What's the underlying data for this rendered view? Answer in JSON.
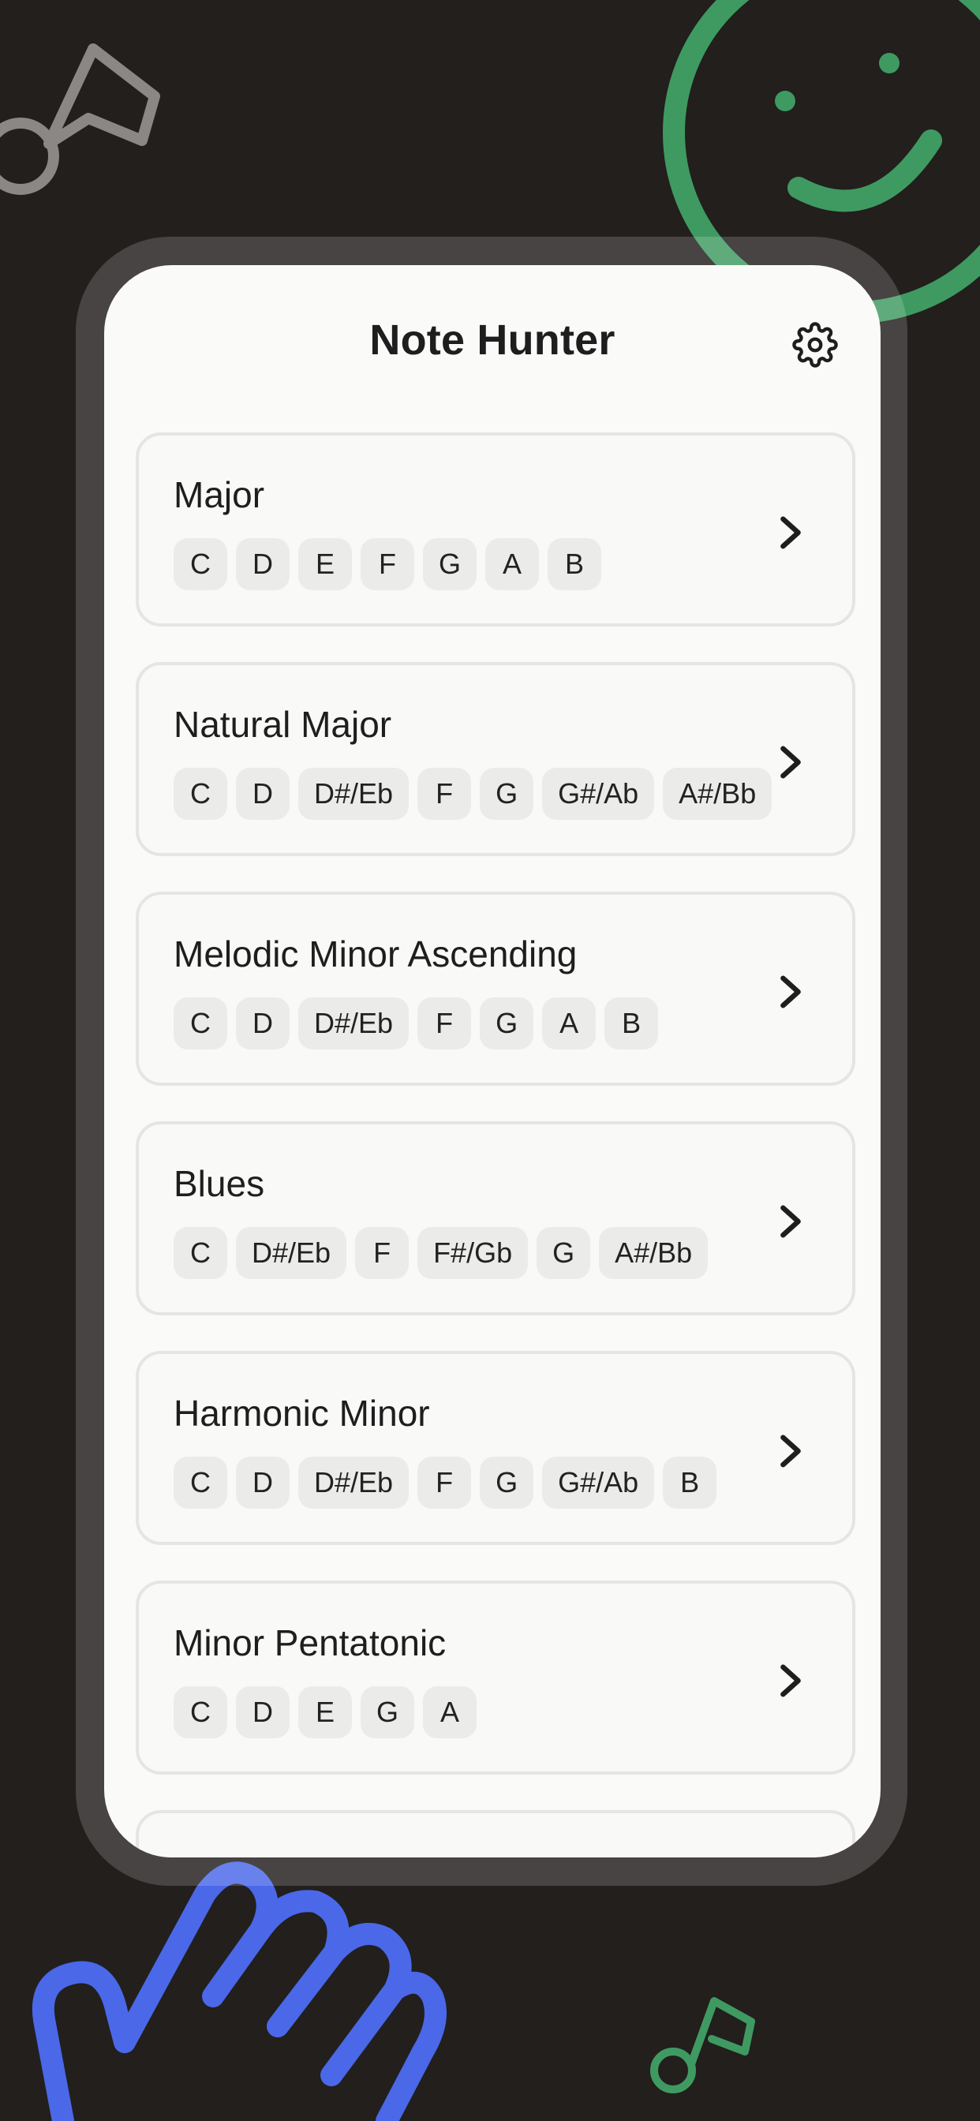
{
  "app": {
    "title": "Note Hunter",
    "settings_icon": "gear-icon"
  },
  "scales": [
    {
      "name": "Major",
      "notes": [
        "C",
        "D",
        "E",
        "F",
        "G",
        "A",
        "B"
      ]
    },
    {
      "name": "Natural Major",
      "notes": [
        "C",
        "D",
        "D#/Eb",
        "F",
        "G",
        "G#/Ab",
        "A#/Bb"
      ]
    },
    {
      "name": "Melodic Minor Ascending",
      "notes": [
        "C",
        "D",
        "D#/Eb",
        "F",
        "G",
        "A",
        "B"
      ]
    },
    {
      "name": "Blues",
      "notes": [
        "C",
        "D#/Eb",
        "F",
        "F#/Gb",
        "G",
        "A#/Bb"
      ]
    },
    {
      "name": "Harmonic Minor",
      "notes": [
        "C",
        "D",
        "D#/Eb",
        "F",
        "G",
        "G#/Ab",
        "B"
      ]
    },
    {
      "name": "Minor Pentatonic",
      "notes": [
        "C",
        "D",
        "E",
        "G",
        "A"
      ]
    }
  ],
  "colors": {
    "background": "#221f1d",
    "screen": "#fafaf8",
    "accent_green": "#3f9a61",
    "accent_blue": "#4a68e8",
    "deco_grey": "#8a8784"
  }
}
